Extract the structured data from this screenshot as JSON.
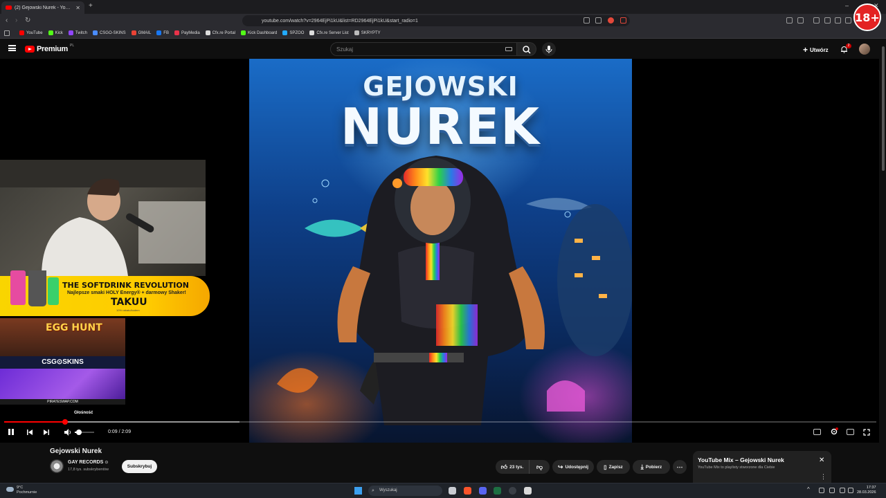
{
  "browser": {
    "tab_title": "(2) Gejowski Nurek - YouTube",
    "url": "youtube.com/watch?v=2964EjPi1kU&list=RD2964EjPi1kU&start_radio=1",
    "bookmarks": [
      {
        "label": "YouTube",
        "color": "#ff0000"
      },
      {
        "label": "Kick",
        "color": "#53fc18"
      },
      {
        "label": "Twitch",
        "color": "#9146ff"
      },
      {
        "label": "CSGO-SKINS",
        "color": "#4a8cff"
      },
      {
        "label": "GMAIL",
        "color": "#ea4335"
      },
      {
        "label": "FB",
        "color": "#1877f2"
      },
      {
        "label": "PayMedia",
        "color": "#e8334a"
      },
      {
        "label": "Cfx.re Portal",
        "color": "#dddddd"
      },
      {
        "label": "Kick Dashboard",
        "color": "#53fc18"
      },
      {
        "label": "SPZOO",
        "color": "#22aaff"
      },
      {
        "label": "Cfx.re Server List",
        "color": "#dddddd"
      },
      {
        "label": "SKRYPTY",
        "color": "#bbbbbb"
      }
    ]
  },
  "age_badge": "18+",
  "youtube": {
    "logo_text": "Premium",
    "logo_region": "PL",
    "search_placeholder": "Szukaj",
    "create_label": "Utwórz",
    "notification_count": "2"
  },
  "artwork": {
    "title_line1": "GEJOWSKI",
    "title_line2": "NUREK"
  },
  "overlay": {
    "promo_headline": "THE SOFTDRINK REVOLUTION",
    "promo_sub": "Najlepsze smaki HOLY Energy® + darmowy Shaker!",
    "promo_code": "TAKUU",
    "promo_small": "10% rabatu/kodem",
    "egg_hunt": "EGG HUNT",
    "csgo": "CSG⊙SKINS",
    "pirate": "PIRATESWAP.COM"
  },
  "player": {
    "tooltip": "Głośność",
    "time": "0:09 / 2:09",
    "progress": 0.07,
    "buffered": 0.27,
    "volume": 0.2
  },
  "video": {
    "title": "Gejowski Nurek",
    "channel": "GAY RECORDS",
    "verified": "⊙",
    "subscribers": "17,8 tys. subskrybentów",
    "subscribe": "Subskrybuj",
    "likes": "23 tys.",
    "share": "Udostępnij",
    "save": "Zapisz",
    "download": "Pobierz"
  },
  "mix": {
    "title": "YouTube Mix – Gejowski Nurek",
    "subtitle": "YouTube Mix to playlisty stworzone dla Ciebie"
  },
  "taskbar": {
    "temp": "9°C",
    "weather": "Pochmurnie",
    "search": "Wyszukaj",
    "time": "17:37",
    "date": "28.03.2026"
  }
}
